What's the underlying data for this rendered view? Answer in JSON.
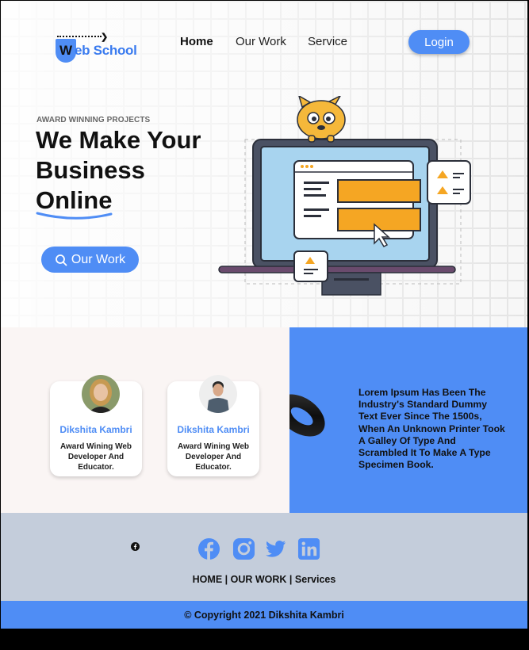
{
  "brand": {
    "logo_letter": "W",
    "logo_text": "eb School"
  },
  "nav": {
    "home": "Home",
    "our_work": "Our Work",
    "service": "Service",
    "login": "Login"
  },
  "hero": {
    "eyebrow": "AWARD WINNING PROJECTS",
    "title_lines": [
      "We Make Your",
      "Business",
      "Online"
    ],
    "cta": "Our Work"
  },
  "team": [
    {
      "name": "Dikshita Kambri",
      "role": "Award Wining Web Developer And Educator."
    },
    {
      "name": "Dikshita Kambri",
      "role": "Award Wining Web Developer And Educator."
    }
  ],
  "blurb": "Lorem Ipsum Has Been The Industry's Standard Dummy Text Ever Since The 1500s, When An Unknown Printer Took A Galley Of Type And Scrambled It To Make A Type Specimen Book.",
  "footer": {
    "links": [
      "HOME",
      "OUR WORK",
      "Services"
    ],
    "separator": " | ",
    "social_icons": [
      "facebook-icon",
      "instagram-icon",
      "twitter-icon",
      "linkedin-icon"
    ],
    "copyright": "© Copyright 2021 Dikshita Kambri"
  },
  "colors": {
    "accent": "#4f8df5",
    "footer_bg": "#c4cddb",
    "team_bg": "#faf5f4"
  }
}
